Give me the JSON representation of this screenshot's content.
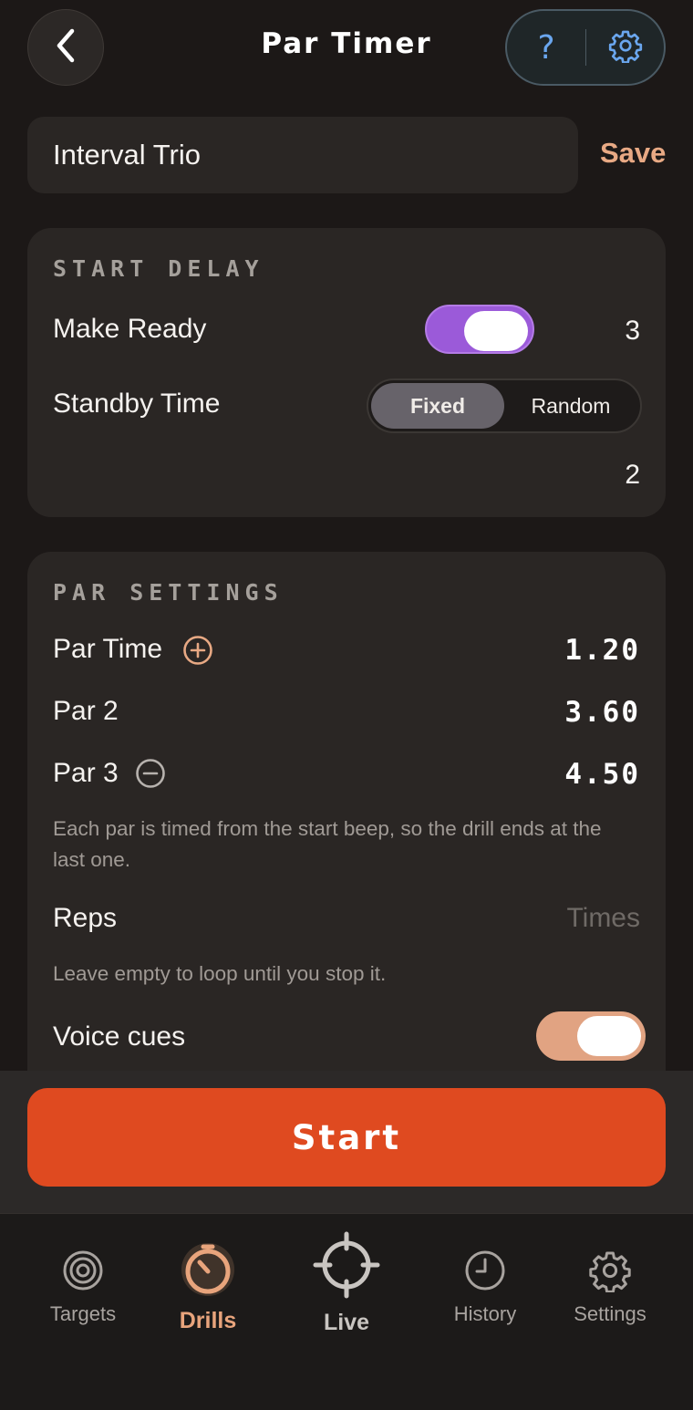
{
  "header": {
    "title": "Par Timer",
    "help_glyph": "?",
    "back_icon": "chevron-left-icon",
    "settings_icon": "gear-icon"
  },
  "drill_name": {
    "value": "Interval Trio",
    "save_label": "Save"
  },
  "start_delay": {
    "title": "START DELAY",
    "make_ready": {
      "label": "Make Ready",
      "enabled": true,
      "value": "3"
    },
    "standby": {
      "label": "Standby Time",
      "options": [
        "Fixed",
        "Random"
      ],
      "selected": "Fixed",
      "value": "2"
    }
  },
  "par_settings": {
    "title": "PAR SETTINGS",
    "pars": [
      {
        "label": "Par Time",
        "value": "1.20",
        "action_icon": "plus-circle-icon"
      },
      {
        "label": "Par 2",
        "value": "3.60"
      },
      {
        "label": "Par 3",
        "value": "4.50",
        "action_icon": "minus-circle-icon"
      }
    ],
    "help": "Each par is timed from the start beep, so the drill ends at the last one.",
    "reps": {
      "label": "Reps",
      "placeholder": "Times",
      "value": ""
    },
    "reps_help": "Leave empty to loop until you stop it.",
    "voice_cues": {
      "label": "Voice cues",
      "enabled": true
    }
  },
  "start_button": {
    "label": "Start"
  },
  "tabs": [
    {
      "label": "Targets",
      "icon": "target-icon",
      "active": false
    },
    {
      "label": "Drills",
      "icon": "timer-icon",
      "active": true
    },
    {
      "label": "Live",
      "icon": "crosshair-icon",
      "active": false
    },
    {
      "label": "History",
      "icon": "clock-icon",
      "active": false
    },
    {
      "label": "Settings",
      "icon": "gear-icon",
      "active": false
    }
  ],
  "colors": {
    "accent": "#e8a984",
    "start": "#df4a20",
    "toggle_make_ready": "#9b5ad9",
    "toggle_voice": "#e1a382",
    "help_icon": "#6aa6ee"
  }
}
